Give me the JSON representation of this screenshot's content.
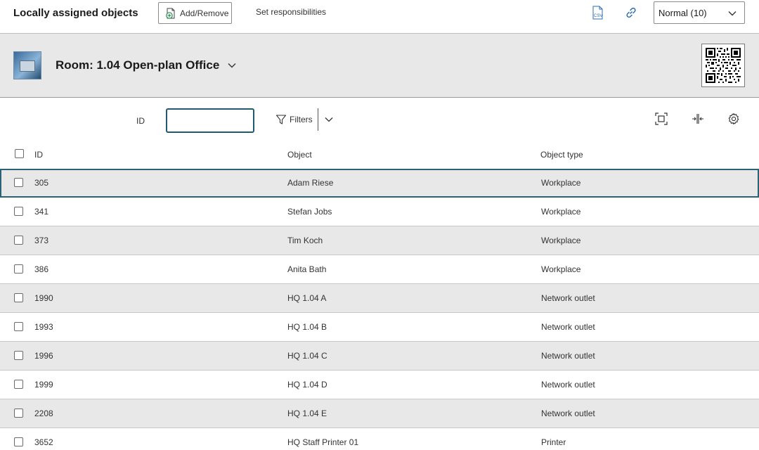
{
  "toolbar": {
    "title": "Locally assigned objects",
    "add_remove_label": "Add/Remove",
    "set_responsibilities_label": "Set responsibilities",
    "csv_icon_text": "CSV",
    "level_select_value": "Normal (10)"
  },
  "room": {
    "title": "Room: 1.04 Open-plan Office"
  },
  "filter": {
    "id_label": "ID",
    "id_value": "",
    "filters_label": "Filters"
  },
  "table": {
    "columns": [
      "ID",
      "Object",
      "Object type"
    ],
    "rows": [
      {
        "id": "305",
        "object": "Adam Riese",
        "type": "Workplace",
        "selected": true
      },
      {
        "id": "341",
        "object": "Stefan Jobs",
        "type": "Workplace"
      },
      {
        "id": "373",
        "object": "Tim Koch",
        "type": "Workplace"
      },
      {
        "id": "386",
        "object": "Anita Bath",
        "type": "Workplace"
      },
      {
        "id": "1990",
        "object": "HQ 1.04 A",
        "type": "Network outlet"
      },
      {
        "id": "1993",
        "object": "HQ 1.04 B",
        "type": "Network outlet"
      },
      {
        "id": "1996",
        "object": "HQ 1.04 C",
        "type": "Network outlet"
      },
      {
        "id": "1999",
        "object": "HQ 1.04 D",
        "type": "Network outlet"
      },
      {
        "id": "2208",
        "object": "HQ 1.04 E",
        "type": "Network outlet"
      },
      {
        "id": "3652",
        "object": "HQ Staff Printer 01",
        "type": "Printer"
      }
    ]
  },
  "colors": {
    "accent": "#1f5a6e",
    "link_blue": "#2b6cb0",
    "row_alt": "#e8e8e8",
    "header_bg": "#e8e8e8"
  }
}
